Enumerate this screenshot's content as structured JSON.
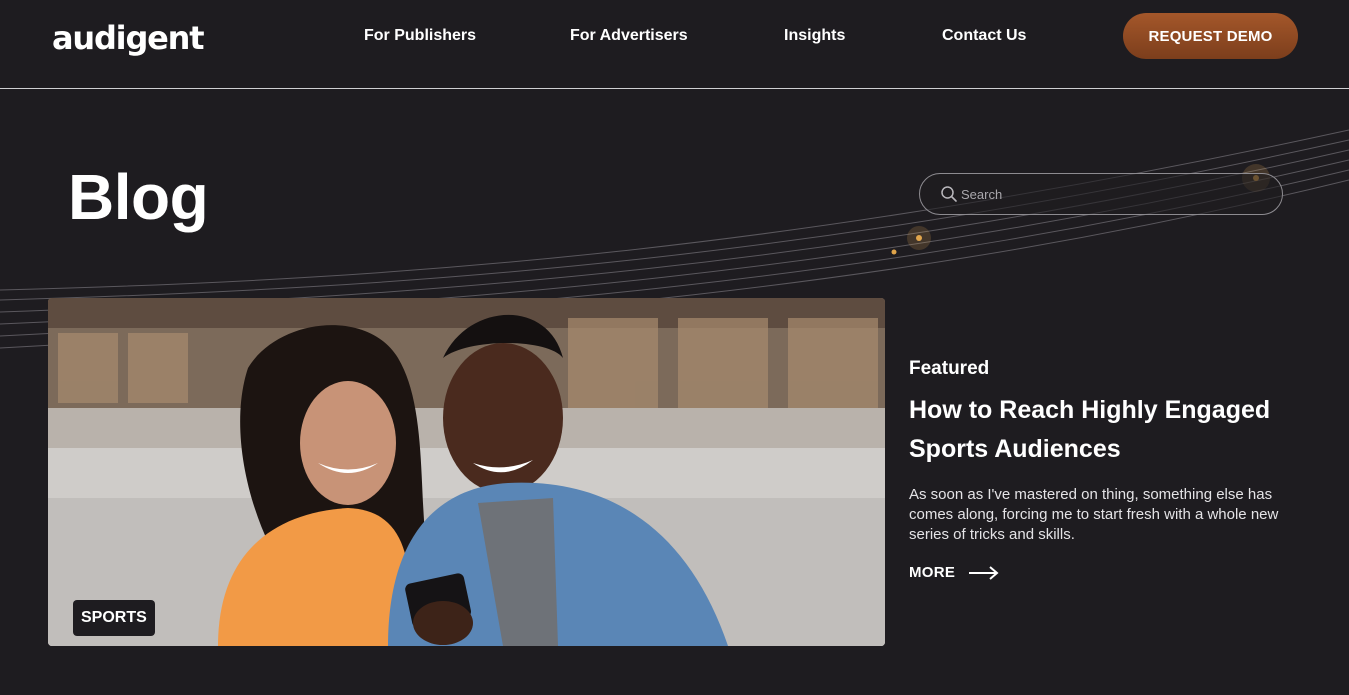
{
  "header": {
    "logo": "audigent",
    "nav": [
      {
        "label": "For Publishers"
      },
      {
        "label": "For Advertisers"
      },
      {
        "label": "Insights"
      },
      {
        "label": "Contact Us"
      }
    ],
    "cta_label": "REQUEST DEMO",
    "cta_color": "#8f4a22"
  },
  "hero": {
    "title": "Blog",
    "search_placeholder": "Search"
  },
  "featured": {
    "label": "Featured",
    "title": "How to Reach Highly Engaged Sports Audiences",
    "excerpt": "As soon as I've mastered on thing, something else has comes along, forcing me to start fresh with a whole new series of tricks and skills.",
    "more_label": "MORE",
    "category_tag": "SPORTS"
  },
  "colors": {
    "background": "#1e1c20",
    "accent": "#a4572a"
  },
  "icons": {
    "search": "search-icon",
    "more": "arrow-right-icon"
  }
}
